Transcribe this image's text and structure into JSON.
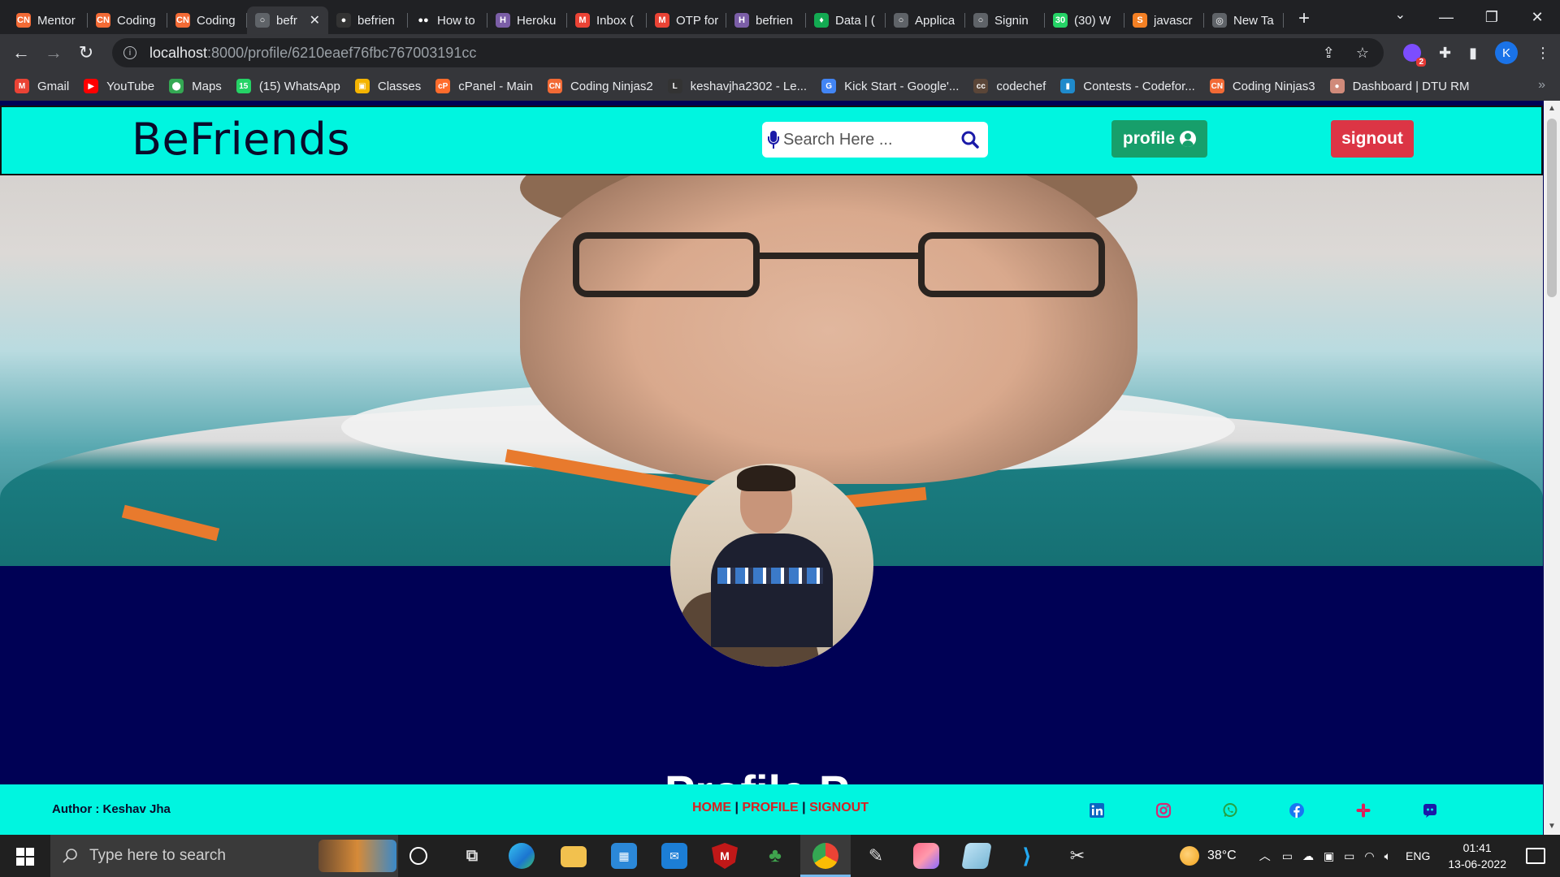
{
  "browser": {
    "tabs": [
      {
        "title": "Mentor",
        "fav": "CN",
        "color": "#f26a35",
        "active": false
      },
      {
        "title": "Coding",
        "fav": "CN",
        "color": "#f26a35",
        "active": false
      },
      {
        "title": "Coding",
        "fav": "CN",
        "color": "#f26a35",
        "active": false
      },
      {
        "title": "befr",
        "fav": "○",
        "color": "#5f6368",
        "active": true
      },
      {
        "title": "befrien",
        "fav": "●",
        "color": "#333333",
        "active": false
      },
      {
        "title": "How to",
        "fav": "●●",
        "color": "#202124",
        "active": false
      },
      {
        "title": "Heroku",
        "fav": "H",
        "color": "#7b5ea7",
        "active": false
      },
      {
        "title": "Inbox (",
        "fav": "M",
        "color": "#ea4335",
        "active": false
      },
      {
        "title": "OTP for",
        "fav": "M",
        "color": "#ea4335",
        "active": false
      },
      {
        "title": "befrien",
        "fav": "H",
        "color": "#7b5ea7",
        "active": false
      },
      {
        "title": "Data | (",
        "fav": "♦",
        "color": "#13aa52",
        "active": false
      },
      {
        "title": "Applica",
        "fav": "○",
        "color": "#5f6368",
        "active": false
      },
      {
        "title": "Signin",
        "fav": "○",
        "color": "#5f6368",
        "active": false
      },
      {
        "title": "(30) W",
        "fav": "30",
        "color": "#25d366",
        "active": false
      },
      {
        "title": "javascr",
        "fav": "S",
        "color": "#f48024",
        "active": false
      },
      {
        "title": "New Ta",
        "fav": "◎",
        "color": "#5f6368",
        "active": false
      }
    ],
    "url_host": "localhost",
    "url_path": ":8000/profile/6210eaef76fbc767003191cc",
    "profile_initial": "K",
    "extension_badge": "2"
  },
  "bookmarks": [
    {
      "label": "Gmail",
      "fav": "M",
      "color": "#ea4335"
    },
    {
      "label": "YouTube",
      "fav": "▶",
      "color": "#ff0000"
    },
    {
      "label": "Maps",
      "fav": "⬤",
      "color": "#34a853"
    },
    {
      "label": "(15) WhatsApp",
      "fav": "15",
      "color": "#25d366"
    },
    {
      "label": "Classes",
      "fav": "▣",
      "color": "#f4b400"
    },
    {
      "label": "cPanel - Main",
      "fav": "cP",
      "color": "#ff6c2c"
    },
    {
      "label": "Coding Ninjas2",
      "fav": "CN",
      "color": "#f26a35"
    },
    {
      "label": "keshavjha2302 - Le...",
      "fav": "L",
      "color": "#333333"
    },
    {
      "label": "Kick Start - Google'...",
      "fav": "G",
      "color": "#4285f4"
    },
    {
      "label": "codechef",
      "fav": "cc",
      "color": "#5b4638"
    },
    {
      "label": "Contests - Codefor...",
      "fav": "▮",
      "color": "#1f8acb"
    },
    {
      "label": "Coding Ninjas3",
      "fav": "CN",
      "color": "#f26a35"
    },
    {
      "label": "Dashboard | DTU RM",
      "fav": "●",
      "color": "#d08a7a"
    }
  ],
  "site": {
    "brand": "BeFriends",
    "search_placeholder": "Search Here ...",
    "profile_label": "profile",
    "signout_label": "signout",
    "section_title": "Profile P",
    "footer": {
      "author": "Author : Keshav Jha",
      "links": [
        "HOME",
        "PROFILE",
        "SIGNOUT"
      ],
      "separator": " | ",
      "socials": [
        "linkedin-icon",
        "instagram-icon",
        "whatsapp-icon",
        "facebook-icon",
        "slack-icon",
        "discord-icon"
      ]
    },
    "colors": {
      "nav_bg": "#00f5e0",
      "page_bg": "#000155",
      "profile_btn": "#179f6b",
      "signout_btn": "#dc3545",
      "footer_link": "#d92020"
    }
  },
  "taskbar": {
    "search_placeholder": "Type here to search",
    "temperature": "38°C",
    "language": "ENG",
    "time": "01:41",
    "date": "13-06-2022"
  }
}
